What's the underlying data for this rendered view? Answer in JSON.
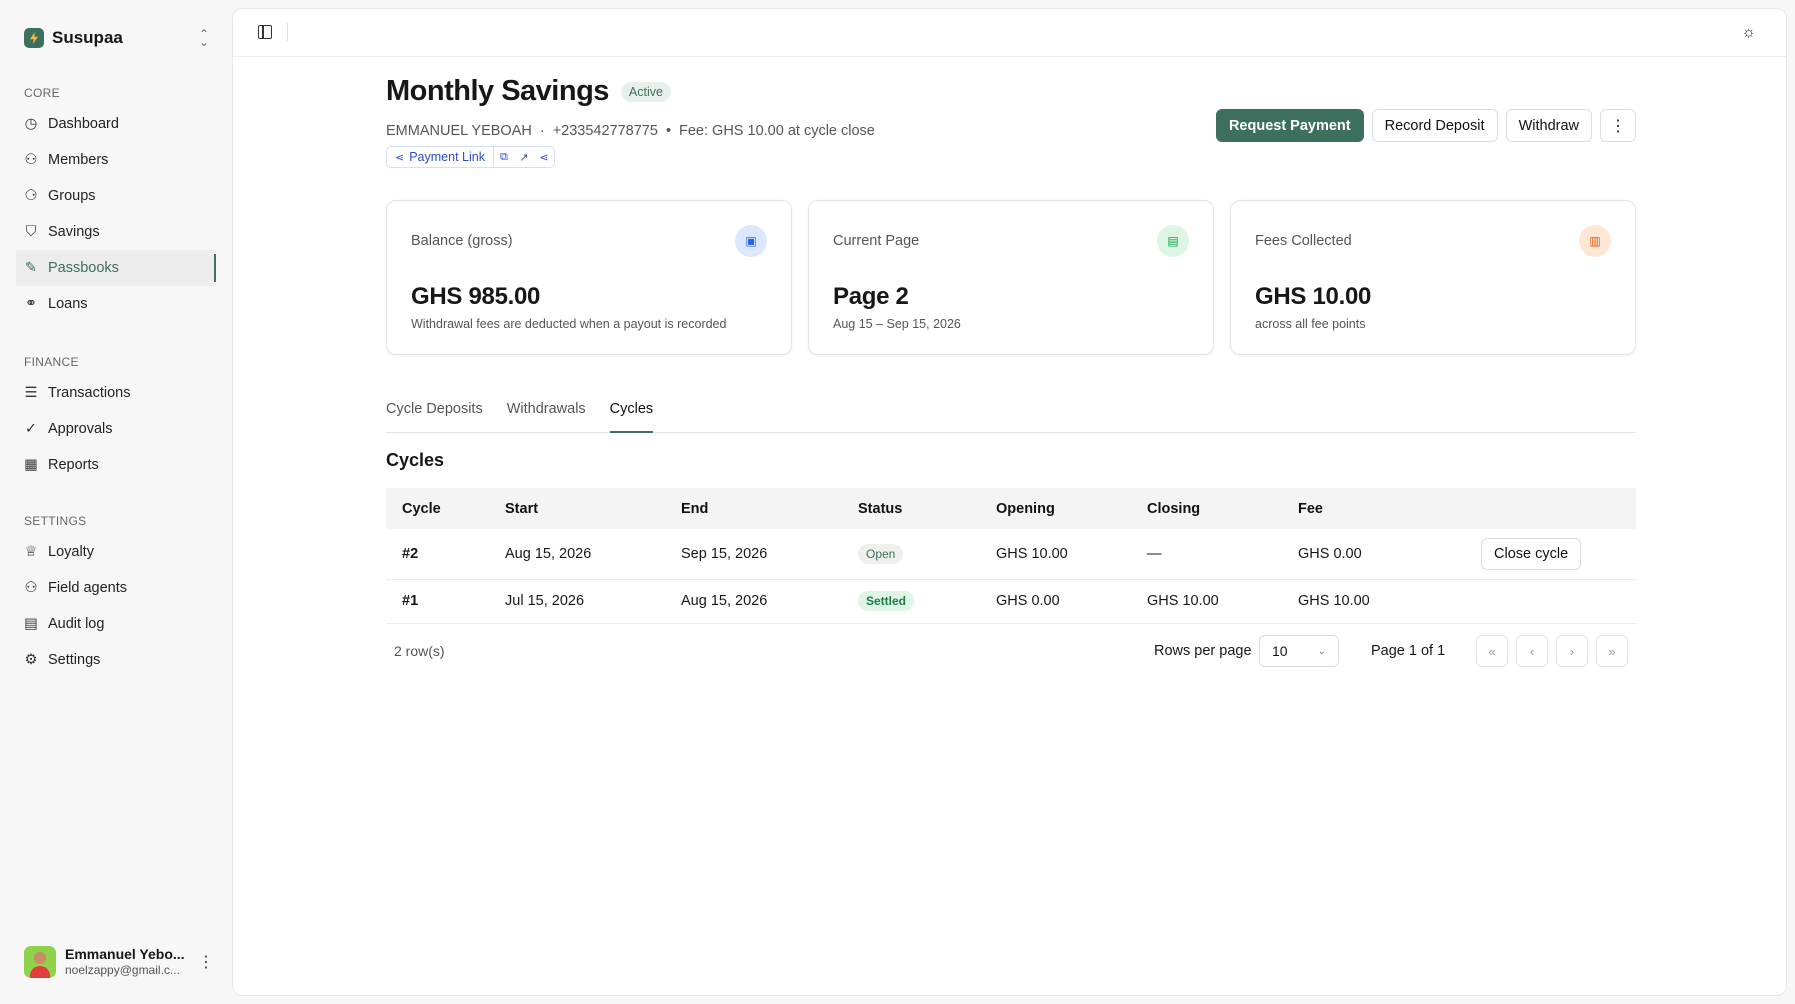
{
  "sidebar": {
    "brand": "Susupaa",
    "sections": [
      {
        "heading": "CORE",
        "items": [
          {
            "label": "Dashboard",
            "icon": "◷"
          },
          {
            "label": "Members",
            "icon": "⚇"
          },
          {
            "label": "Groups",
            "icon": "⚆"
          },
          {
            "label": "Savings",
            "icon": "⛉"
          },
          {
            "label": "Passbooks",
            "icon": "✎"
          },
          {
            "label": "Loans",
            "icon": "⚭"
          }
        ]
      },
      {
        "heading": "FINANCE",
        "items": [
          {
            "label": "Transactions",
            "icon": "☰"
          },
          {
            "label": "Approvals",
            "icon": "✓"
          },
          {
            "label": "Reports",
            "icon": "▦"
          }
        ]
      },
      {
        "heading": "SETTINGS",
        "items": [
          {
            "label": "Loyalty",
            "icon": "♕"
          },
          {
            "label": "Field agents",
            "icon": "⚇"
          },
          {
            "label": "Audit log",
            "icon": "▤"
          },
          {
            "label": "Settings",
            "icon": "⚙"
          }
        ]
      }
    ],
    "user": {
      "name": "Emmanuel Yebo...",
      "email": "noelzappy@gmail.c..."
    }
  },
  "header": {
    "title": "Monthly Savings",
    "status": "Active",
    "member_name": "EMMANUEL YEBOAH",
    "phone": "+233542778775",
    "fee_info": "Fee: GHS 10.00 at cycle close",
    "payment_link": "Payment Link",
    "separator": "·",
    "separator2": "•"
  },
  "actions": {
    "request_payment": "Request Payment",
    "record_deposit": "Record Deposit",
    "withdraw": "Withdraw"
  },
  "cards": [
    {
      "label": "Balance (gross)",
      "value": "GHS 985.00",
      "sub": "Withdrawal fees are deducted when a payout is recorded",
      "icon_color": "#2563eb",
      "icon_bg": "#dbe7fe"
    },
    {
      "label": "Current Page",
      "value": "Page 2",
      "sub": "Aug 15 – Sep 15, 2026",
      "icon_color": "#16a34a",
      "icon_bg": "#dcf6e3"
    },
    {
      "label": "Fees Collected",
      "value": "GHS 10.00",
      "sub": "across all fee points",
      "icon_color": "#ea580c",
      "icon_bg": "#fde7d4"
    }
  ],
  "tabs": [
    "Cycle Deposits",
    "Withdrawals",
    "Cycles"
  ],
  "active_tab": "Cycles",
  "cycles": {
    "title": "Cycles",
    "columns": [
      "Cycle",
      "Start",
      "End",
      "Status",
      "Opening",
      "Closing",
      "Fee"
    ],
    "rows": [
      {
        "cycle": "#2",
        "start": "Aug 15, 2026",
        "end": "Sep 15, 2026",
        "status": "Open",
        "opening": "GHS 10.00",
        "closing": "—",
        "fee": "GHS 0.00",
        "action": "Close cycle"
      },
      {
        "cycle": "#1",
        "start": "Jul 15, 2026",
        "end": "Aug 15, 2026",
        "status": "Settled",
        "opening": "GHS 0.00",
        "closing": "GHS 10.00",
        "fee": "GHS 10.00",
        "action": ""
      }
    ],
    "row_count": "2 row(s)",
    "rows_per_page_label": "Rows per page",
    "rows_per_page": "10",
    "page_info": "Page 1 of 1"
  }
}
